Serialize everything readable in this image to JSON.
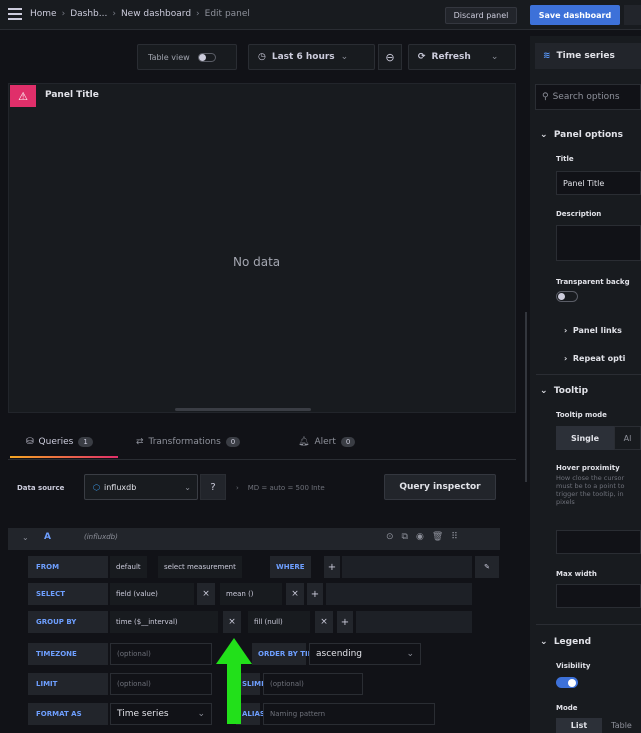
{
  "topbar": {
    "breadcrumb": [
      "Home",
      "Dashb...",
      "New dashboard",
      "Edit panel"
    ],
    "discard_label": "Discard panel",
    "save_label": "Save dashboard"
  },
  "toolbar": {
    "table_view_label": "Table view",
    "time_range_label": "Last 6 hours",
    "refresh_label": "Refresh"
  },
  "panel": {
    "title": "Panel Title",
    "empty_message": "No data"
  },
  "tabs": [
    {
      "label": "Queries",
      "count": "1"
    },
    {
      "label": "Transformations",
      "count": "0"
    },
    {
      "label": "Alert",
      "count": "0"
    }
  ],
  "datasource": {
    "label": "Data source",
    "value": "influxdb",
    "options_summary": "MD = auto = 500   Inte",
    "query_inspector_label": "Query inspector"
  },
  "query": {
    "letter": "A",
    "datasource_name": "(influxdb)",
    "from": {
      "label": "FROM",
      "policy": "default",
      "measurement": "select measurement",
      "where": "WHERE"
    },
    "select": {
      "label": "SELECT",
      "field": "field (value)",
      "fn": "mean ()"
    },
    "group_by": {
      "label": "GROUP BY",
      "time": "time ($__interval)",
      "fill": "fill (null)"
    },
    "timezone": {
      "label": "TIMEZONE",
      "placeholder": "(optional)",
      "order_label": "ORDER BY TIME",
      "order_value": "ascending"
    },
    "limit": {
      "label": "LIMIT",
      "placeholder": "(optional)",
      "slimit_label": "SLIMIT",
      "slimit_placeholder": "(optional)"
    },
    "format_as": {
      "label": "FORMAT AS",
      "value": "Time series",
      "alias_label": "ALIAS",
      "alias_placeholder": "Naming pattern"
    }
  },
  "sidebar": {
    "viz_label": "Time series",
    "search_placeholder": "Search options",
    "panel_options_label": "Panel options",
    "title_label": "Title",
    "title_value": "Panel Title",
    "description_label": "Description",
    "transparent_label": "Transparent backg",
    "panel_links_label": "Panel links",
    "repeat_options_label": "Repeat opti",
    "tooltip_label": "Tooltip",
    "tooltip_mode_label": "Tooltip mode",
    "tooltip_modes": [
      "Single",
      "Al"
    ],
    "hover_label": "Hover proximity",
    "hover_desc": "How close the cursor must be to a point to trigger the tooltip, in pixels",
    "max_width_label": "Max width",
    "legend_label": "Legend",
    "visibility_label": "Visibility",
    "mode_label": "Mode",
    "legend_modes": [
      "List",
      "Table"
    ]
  },
  "colors": {
    "accent_blue": "#3d71d9",
    "keyword_blue": "#6e9fff",
    "panel_icon": "#e02f6a",
    "arrow_green": "#22e01a"
  }
}
